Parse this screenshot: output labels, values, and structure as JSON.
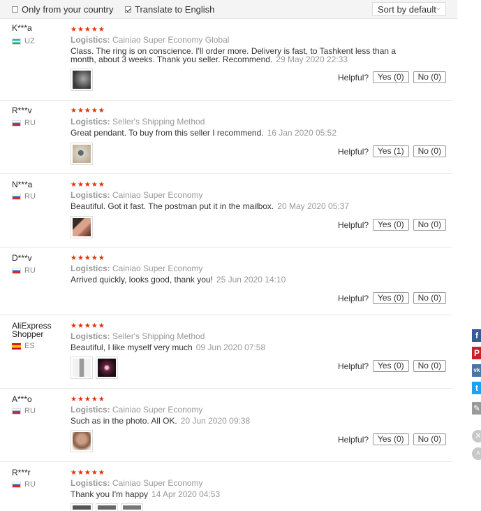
{
  "filters": {
    "only_country": "Only from your country",
    "translate": "Translate to English",
    "sort": "Sort by default"
  },
  "labels": {
    "logistics": "Logistics:",
    "helpful": "Helpful?"
  },
  "reviews": [
    {
      "name": "K***a",
      "country": "UZ",
      "flag": "uz",
      "logistics": "Cainiao Super Economy Global",
      "text": "Class. The ring is on conscience. I'll order more. Delivery is fast, to Tashkent less than a month, about 3 weeks. Thank you seller. Recommend.",
      "date": "29 May 2020 22:33",
      "yes": "Yes (0)",
      "no": "No (0)"
    },
    {
      "name": "R***v",
      "country": "RU",
      "flag": "ru",
      "logistics": "Seller's Shipping Method",
      "text": "Great pendant. To buy from this seller I recommend.",
      "date": "16 Jan 2020 05:52",
      "yes": "Yes (1)",
      "no": "No (0)"
    },
    {
      "name": "N***a",
      "country": "RU",
      "flag": "ru",
      "logistics": "Cainiao Super Economy",
      "text": "Beautiful. Got it fast. The postman put it in the mailbox.",
      "date": "20 May 2020 05:37",
      "yes": "Yes (0)",
      "no": "No (0)"
    },
    {
      "name": "D***v",
      "country": "RU",
      "flag": "ru",
      "logistics": "Cainiao Super Economy",
      "text": "Arrived quickly, looks good, thank you!",
      "date": "25 Jun 2020 14:10",
      "yes": "Yes (0)",
      "no": "No (0)"
    },
    {
      "name": "AliExpress Shopper",
      "country": "ES",
      "flag": "es",
      "logistics": "Seller's Shipping Method",
      "text": "Beautiful, I like myself very much",
      "date": "09 Jun 2020 07:58",
      "yes": "Yes (0)",
      "no": "No (0)"
    },
    {
      "name": "A***o",
      "country": "RU",
      "flag": "ru",
      "logistics": "Cainiao Super Economy",
      "text": "Such as in the photo. All OK.",
      "date": "20 Jun 2020 09:38",
      "yes": "Yes (0)",
      "no": "No (0)"
    },
    {
      "name": "R***r",
      "country": "RU",
      "flag": "ru",
      "logistics": "Cainiao Super Economy",
      "text": "Thank you I'm happy",
      "date": "14 Apr 2020 04:53"
    }
  ],
  "social": {
    "facebook": "f",
    "pinterest": "P",
    "vk": "vk",
    "twitter": "t"
  },
  "colors": {
    "star": "#e62e04",
    "facebook": "#3b5998",
    "pinterest": "#cb2027",
    "vk": "#4c75a3",
    "twitter": "#1da1f2"
  }
}
